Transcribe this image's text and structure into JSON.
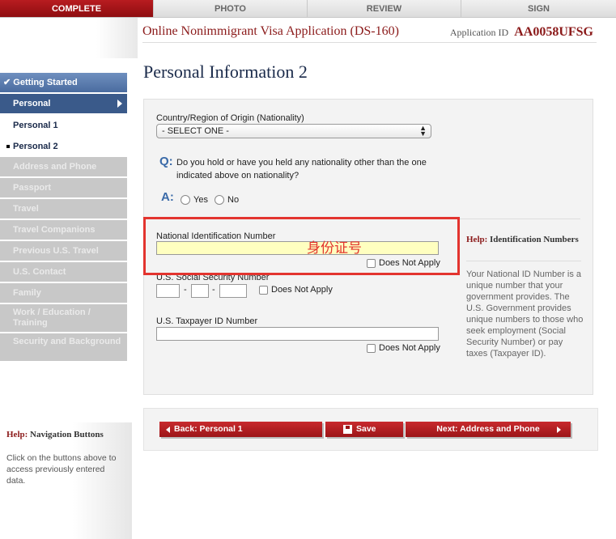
{
  "tabs": [
    {
      "label": "COMPLETE",
      "active": true
    },
    {
      "label": "PHOTO"
    },
    {
      "label": "REVIEW"
    },
    {
      "label": "SIGN"
    }
  ],
  "header": {
    "title": "Online Nonimmigrant Visa Application (DS-160)",
    "app_id_label": "Application ID",
    "app_id": "AA0058UFSG"
  },
  "page_title": "Personal Information 2",
  "sidebar": {
    "items": [
      {
        "label": "✔ Getting Started"
      },
      {
        "label": "Personal"
      },
      {
        "label": "Personal 1"
      },
      {
        "label": "Personal 2"
      },
      {
        "label": "Address and Phone"
      },
      {
        "label": "Passport"
      },
      {
        "label": "Travel"
      },
      {
        "label": "Travel Companions"
      },
      {
        "label": "Previous U.S. Travel"
      },
      {
        "label": "U.S. Contact"
      },
      {
        "label": "Family"
      },
      {
        "label": "Work / Education / Training"
      },
      {
        "label": "Security and Background"
      }
    ],
    "help_title_red": "Help:",
    "help_title": "Navigation Buttons",
    "help_text": "Click on the buttons above to access previously entered data."
  },
  "form": {
    "nationality_label": "Country/Region of Origin (Nationality)",
    "nationality_value": "- SELECT ONE -",
    "q_mark": "Q:",
    "question": "Do you hold or have you held any nationality other than the one indicated above on nationality?",
    "a_mark": "A:",
    "yes_label": "Yes",
    "no_label": "No",
    "nid_label": "National Identification Number",
    "nid_value": "",
    "nid_dna_label": "Does Not Apply",
    "ssn_label": "U.S. Social Security Number",
    "ssn_dash": "-",
    "ssn_dna_label": "Does Not Apply",
    "tax_label": "U.S. Taxpayer ID Number",
    "tax_dna_label": "Does Not Apply",
    "annotation": "身份证号"
  },
  "help": {
    "title_red": "Help:",
    "title": "Identification Numbers",
    "text": "Your National ID Number is a unique number that your government provides. The U.S. Government provides unique numbers to those who seek employment (Social Security Number) or pay taxes (Taxpayer ID)."
  },
  "buttons": {
    "back": "Back: Personal 1",
    "save": "Save",
    "next": "Next: Address and Phone"
  }
}
